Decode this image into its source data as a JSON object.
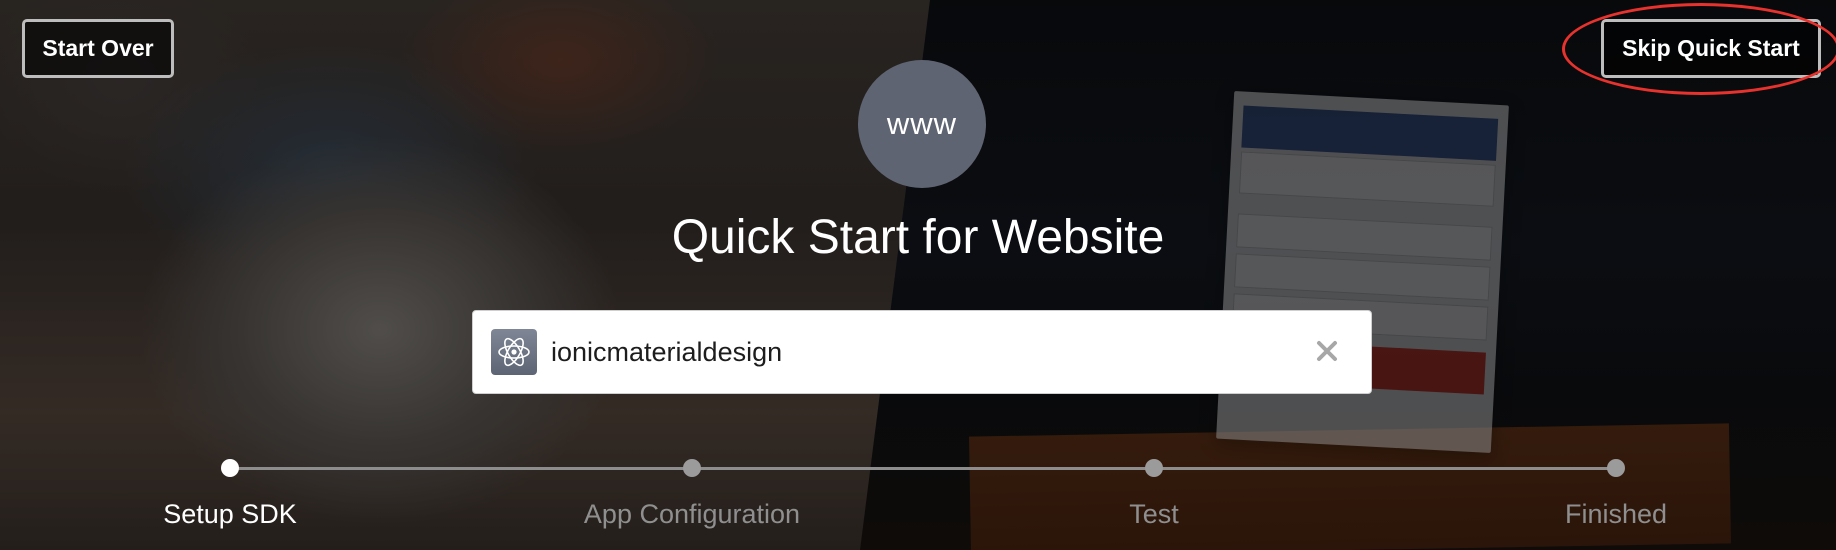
{
  "header": {
    "start_over_label": "Start Over",
    "skip_label": "Skip Quick Start"
  },
  "platform": {
    "badge_text": "www",
    "title": "Quick Start for Website"
  },
  "app_picker": {
    "app_name": "ionicmaterialdesign",
    "app_icon": "atom-icon",
    "clear_icon": "close-icon"
  },
  "stepper": {
    "steps": [
      {
        "label": "Setup SDK",
        "active": true
      },
      {
        "label": "App Configuration",
        "active": false
      },
      {
        "label": "Test",
        "active": false
      },
      {
        "label": "Finished",
        "active": false
      }
    ]
  },
  "colors": {
    "highlight": "#e8322e",
    "badge_bg": "#5f6472",
    "active_step": "#ffffff",
    "inactive_step": "#8f8f8f"
  }
}
